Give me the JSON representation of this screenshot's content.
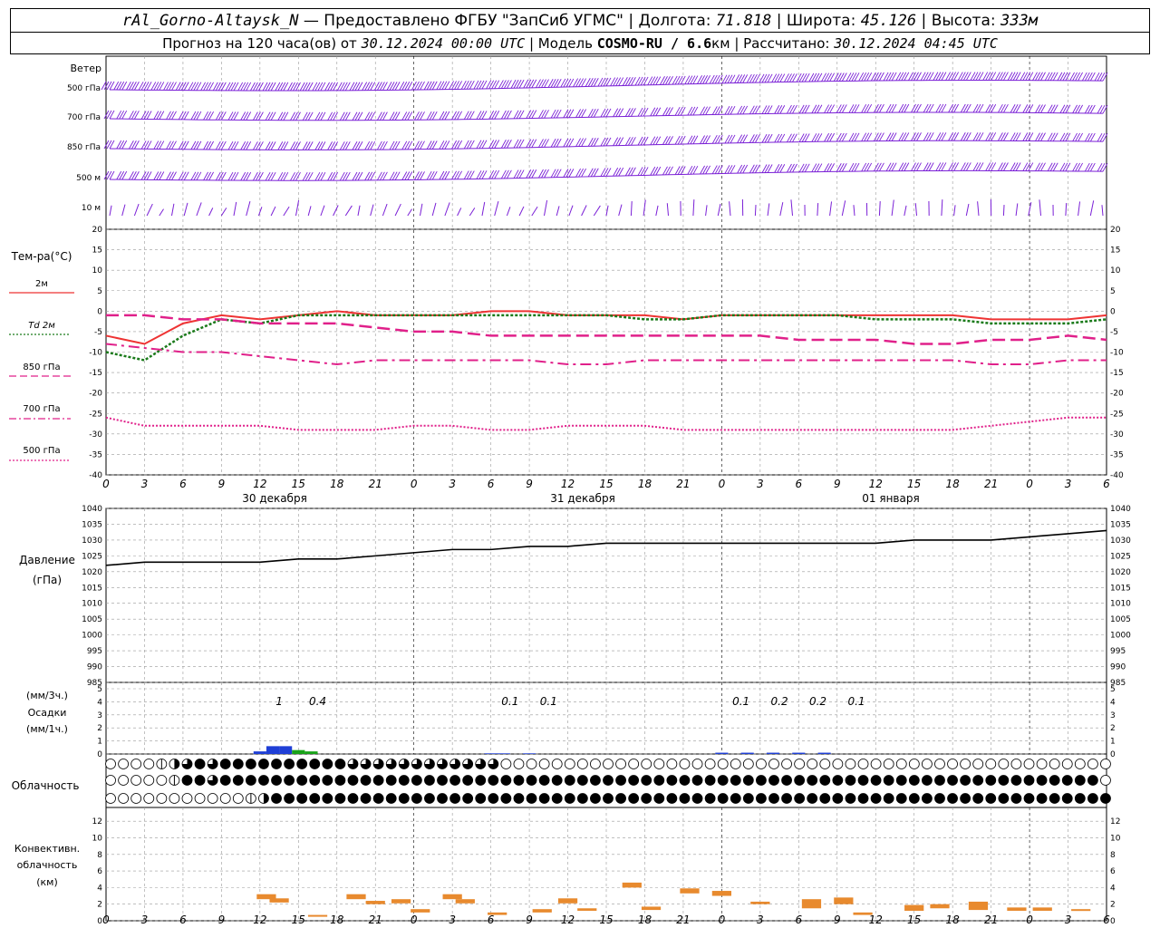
{
  "header": {
    "station": "rAl_Gorno-Altaysk_N",
    "provider": "— Предоставлено ФГБУ \"ЗапСиб УГМС\"",
    "lon_label": "Долгота:",
    "lon": "71.818",
    "lat_label": "Широта:",
    "lat": "45.126",
    "alt_label": "Высота:",
    "alt": "333м",
    "forecast_label": "Прогноз на 120 часа(ов) от",
    "forecast_start": "30.12.2024 00:00 UTC",
    "model_label": "Модель",
    "model": "COSMO-RU / 6.6",
    "model_unit": "км",
    "calc_label": "Рассчитано:",
    "calc_time": "30.12.2024 04:45 UTC"
  },
  "colors": {
    "wind": "#7a1fd6",
    "t2m": "#ee3333",
    "td2m": "#1a7a1a",
    "t850": "#e0208a",
    "t700": "#e0208a",
    "t500": "#e0208a",
    "pressure": "#000000",
    "precip_rain": "#1f3fd6",
    "precip_snow": "#19a319",
    "convective": "#e88a2e",
    "grid": "#999999"
  },
  "wind_panel": {
    "title": "Ветер",
    "levels": [
      "500 гПа",
      "700 гПа",
      "850 гПа",
      "500 м",
      "10 м"
    ]
  },
  "temp_panel": {
    "title": "Тем-ра(°С)",
    "legend": [
      {
        "label": "2м",
        "style": "solid",
        "color": "#ee3333"
      },
      {
        "label": "Td 2м",
        "style": "dotted",
        "color": "#1a7a1a"
      },
      {
        "label": "850 гПа",
        "style": "dashed",
        "color": "#e0208a"
      },
      {
        "label": "700 гПа",
        "style": "dashdot",
        "color": "#e0208a"
      },
      {
        "label": "500 гПа",
        "style": "fine-dotted",
        "color": "#e0208a"
      }
    ]
  },
  "pressure_panel": {
    "title": "Давление",
    "unit": "(гПа)"
  },
  "precip_panel": {
    "unit3h": "(мм/3ч.)",
    "title": "Осадки",
    "unit1h": "(мм/1ч.)"
  },
  "cloud_panel": {
    "title": "Облачность"
  },
  "conv_panel": {
    "title": "Конвективн.",
    "title2": "облачность",
    "unit": "(км)"
  },
  "time_axis": {
    "tick_labels": [
      "0",
      "3",
      "6",
      "9",
      "12",
      "15",
      "18",
      "21",
      "0",
      "3",
      "6",
      "9",
      "12",
      "15",
      "18",
      "21",
      "0",
      "3",
      "6",
      "9",
      "12",
      "15",
      "18",
      "21",
      "0",
      "3",
      "6"
    ],
    "days": [
      "30 декабря",
      "31 декабря",
      "01 января"
    ]
  },
  "chart_data": [
    {
      "type": "line",
      "title": "Тем-ра(°С)",
      "x_hours": [
        0,
        3,
        6,
        9,
        12,
        15,
        18,
        21,
        24,
        27,
        30,
        33,
        36,
        39,
        42,
        45,
        48,
        51,
        54,
        57,
        60,
        63,
        66,
        69,
        72,
        75,
        78
      ],
      "ylim": [
        -40,
        20
      ],
      "yticks": [
        20,
        15,
        10,
        5,
        0,
        -5,
        -10,
        -15,
        -20,
        -25,
        -30,
        -35,
        -40
      ],
      "series": [
        {
          "name": "2м",
          "values": [
            -6,
            -8,
            -3,
            -1,
            -2,
            -1,
            0,
            -1,
            -1,
            -1,
            0,
            0,
            -1,
            -1,
            -1,
            -2,
            -1,
            -1,
            -1,
            -1,
            -1,
            -1,
            -1,
            -2,
            -2,
            -2,
            -1
          ]
        },
        {
          "name": "Td 2м",
          "values": [
            -10,
            -12,
            -6,
            -2,
            -3,
            -1,
            -1,
            -1,
            -1,
            -1,
            -1,
            -1,
            -1,
            -1,
            -2,
            -2,
            -1,
            -1,
            -1,
            -1,
            -2,
            -2,
            -2,
            -3,
            -3,
            -3,
            -2
          ]
        },
        {
          "name": "850 гПа",
          "values": [
            -1,
            -1,
            -2,
            -2,
            -3,
            -3,
            -3,
            -4,
            -5,
            -5,
            -6,
            -6,
            -6,
            -6,
            -6,
            -6,
            -6,
            -6,
            -7,
            -7,
            -7,
            -8,
            -8,
            -7,
            -7,
            -6,
            -7
          ]
        },
        {
          "name": "700 гПа",
          "values": [
            -8,
            -9,
            -10,
            -10,
            -11,
            -12,
            -13,
            -12,
            -12,
            -12,
            -12,
            -12,
            -13,
            -13,
            -12,
            -12,
            -12,
            -12,
            -12,
            -12,
            -12,
            -12,
            -12,
            -13,
            -13,
            -12,
            -12
          ]
        },
        {
          "name": "500 гПа",
          "values": [
            -26,
            -28,
            -28,
            -28,
            -28,
            -29,
            -29,
            -29,
            -28,
            -28,
            -29,
            -29,
            -28,
            -28,
            -28,
            -29,
            -29,
            -29,
            -29,
            -29,
            -29,
            -29,
            -29,
            -28,
            -27,
            -26,
            -26
          ]
        }
      ]
    },
    {
      "type": "line",
      "title": "Давление",
      "x_hours": [
        0,
        3,
        6,
        9,
        12,
        15,
        18,
        21,
        24,
        27,
        30,
        33,
        36,
        39,
        42,
        45,
        48,
        51,
        54,
        57,
        60,
        63,
        66,
        69,
        72,
        75,
        78
      ],
      "ylim": [
        985,
        1040
      ],
      "yticks": [
        1040,
        1035,
        1030,
        1025,
        1020,
        1015,
        1010,
        1005,
        1000,
        995,
        990,
        985
      ],
      "series": [
        {
          "name": "Давление",
          "values": [
            1022,
            1023,
            1023,
            1023,
            1023,
            1024,
            1024,
            1025,
            1026,
            1027,
            1027,
            1028,
            1028,
            1029,
            1029,
            1029,
            1029,
            1029,
            1029,
            1029,
            1029,
            1030,
            1030,
            1030,
            1031,
            1032,
            1033
          ]
        }
      ]
    },
    {
      "type": "bar",
      "title": "Осадки",
      "ylim": [
        0,
        5
      ],
      "yticks": [
        5,
        4,
        3,
        2,
        1,
        0
      ],
      "labels_3h": [
        {
          "x_hour": 13.5,
          "text": "1"
        },
        {
          "x_hour": 16.5,
          "text": "0.4"
        },
        {
          "x_hour": 31.5,
          "text": "0.1"
        },
        {
          "x_hour": 34.5,
          "text": "0.1"
        },
        {
          "x_hour": 49.5,
          "text": "0.1"
        },
        {
          "x_hour": 52.5,
          "text": "0.2"
        },
        {
          "x_hour": 55.5,
          "text": "0.2"
        },
        {
          "x_hour": 58.5,
          "text": "0.1"
        }
      ],
      "bars_1h": [
        {
          "x_hour": 12,
          "value": 0.2,
          "kind": "rain"
        },
        {
          "x_hour": 13,
          "value": 0.6,
          "kind": "rain"
        },
        {
          "x_hour": 14,
          "value": 0.6,
          "kind": "rain"
        },
        {
          "x_hour": 15,
          "value": 0.3,
          "kind": "snow"
        },
        {
          "x_hour": 16,
          "value": 0.2,
          "kind": "snow"
        },
        {
          "x_hour": 30,
          "value": 0.05,
          "kind": "rain"
        },
        {
          "x_hour": 31,
          "value": 0.05,
          "kind": "rain"
        },
        {
          "x_hour": 33,
          "value": 0.05,
          "kind": "rain"
        },
        {
          "x_hour": 48,
          "value": 0.1,
          "kind": "rain"
        },
        {
          "x_hour": 50,
          "value": 0.1,
          "kind": "rain"
        },
        {
          "x_hour": 52,
          "value": 0.1,
          "kind": "rain"
        },
        {
          "x_hour": 54,
          "value": 0.1,
          "kind": "rain"
        },
        {
          "x_hour": 56,
          "value": 0.1,
          "kind": "rain"
        }
      ]
    },
    {
      "type": "bar",
      "title": "Конвективн. облачность",
      "ylim": [
        0,
        13
      ],
      "yticks": [
        12,
        10,
        8,
        6,
        4,
        2,
        0
      ],
      "segments": [
        {
          "x_hour": 12.5,
          "base": 2.6,
          "top": 3.2
        },
        {
          "x_hour": 13.5,
          "base": 2.2,
          "top": 2.7
        },
        {
          "x_hour": 16.5,
          "base": 0.5,
          "top": 0.7
        },
        {
          "x_hour": 19.5,
          "base": 2.6,
          "top": 3.2
        },
        {
          "x_hour": 21,
          "base": 2.0,
          "top": 2.4
        },
        {
          "x_hour": 23,
          "base": 2.1,
          "top": 2.6
        },
        {
          "x_hour": 24.5,
          "base": 1.0,
          "top": 1.4
        },
        {
          "x_hour": 27,
          "base": 2.6,
          "top": 3.2
        },
        {
          "x_hour": 28,
          "base": 2.1,
          "top": 2.6
        },
        {
          "x_hour": 30.5,
          "base": 0.7,
          "top": 1.0
        },
        {
          "x_hour": 34,
          "base": 1.0,
          "top": 1.4
        },
        {
          "x_hour": 36,
          "base": 2.1,
          "top": 2.7
        },
        {
          "x_hour": 37.5,
          "base": 1.2,
          "top": 1.5
        },
        {
          "x_hour": 41,
          "base": 4.0,
          "top": 4.6
        },
        {
          "x_hour": 42.5,
          "base": 1.3,
          "top": 1.7
        },
        {
          "x_hour": 45.5,
          "base": 3.3,
          "top": 3.9
        },
        {
          "x_hour": 48,
          "base": 3.0,
          "top": 3.6
        },
        {
          "x_hour": 51,
          "base": 2.0,
          "top": 2.3
        },
        {
          "x_hour": 55,
          "base": 1.5,
          "top": 2.6
        },
        {
          "x_hour": 57.5,
          "base": 2.0,
          "top": 2.8
        },
        {
          "x_hour": 59,
          "base": 0.7,
          "top": 1.0
        },
        {
          "x_hour": 63,
          "base": 1.2,
          "top": 1.9
        },
        {
          "x_hour": 65,
          "base": 1.5,
          "top": 2.0
        },
        {
          "x_hour": 68,
          "base": 1.3,
          "top": 2.3
        },
        {
          "x_hour": 71,
          "base": 1.2,
          "top": 1.6
        },
        {
          "x_hour": 73,
          "base": 1.2,
          "top": 1.6
        },
        {
          "x_hour": 76,
          "base": 1.2,
          "top": 1.4
        }
      ]
    },
    {
      "type": "table",
      "title": "Облачность",
      "rows": [
        "upper",
        "middle",
        "lower"
      ],
      "hour_step": 1,
      "coverage_0_to_4": [
        "000012343444444444433333333333300000000000000000000000000000000000000000000000000",
        "000001443444444444444444444444444444444444444444444444444444444444444444444444000001434",
        "000000000001244444444444444444444444444444444444444444444444444444444444444444444003444444"
      ]
    }
  ]
}
